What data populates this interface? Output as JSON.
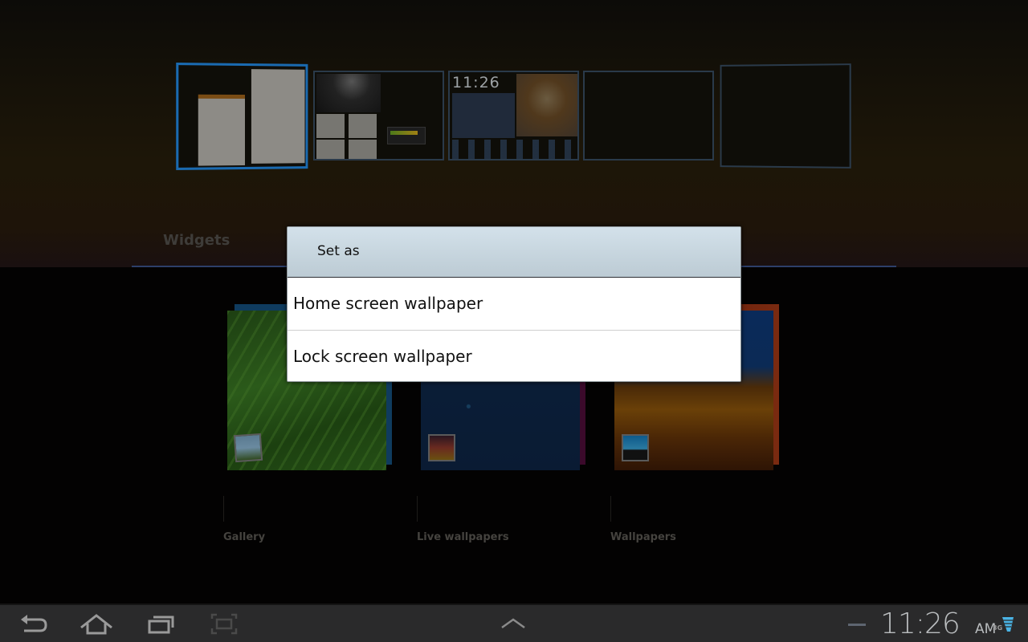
{
  "home_preview": {
    "panes": [
      {
        "name": "pane-1",
        "active": true
      },
      {
        "name": "pane-2",
        "active": false
      },
      {
        "name": "pane-3",
        "active": false,
        "clock": "11:26"
      },
      {
        "name": "pane-4",
        "active": false
      },
      {
        "name": "pane-5",
        "active": false
      }
    ]
  },
  "tabs": {
    "widgets_label": "Widgets"
  },
  "categories": [
    {
      "label": "Gallery",
      "icon": "gallery-icon"
    },
    {
      "label": "Live wallpapers",
      "icon": "live-wallpaper-icon"
    },
    {
      "label": "Wallpapers",
      "icon": "wallpaper-icon"
    }
  ],
  "dialog": {
    "title": "Set as",
    "options": [
      {
        "label": "Home screen wallpaper"
      },
      {
        "label": "Lock screen wallpaper"
      }
    ]
  },
  "system_bar": {
    "buttons": [
      "back-icon",
      "home-icon",
      "recent-apps-icon",
      "screenshot-icon",
      "chevron-up-icon"
    ],
    "time": "11:26",
    "ampm": "AM",
    "network": "3G",
    "accent_color": "#4ab4e6"
  }
}
